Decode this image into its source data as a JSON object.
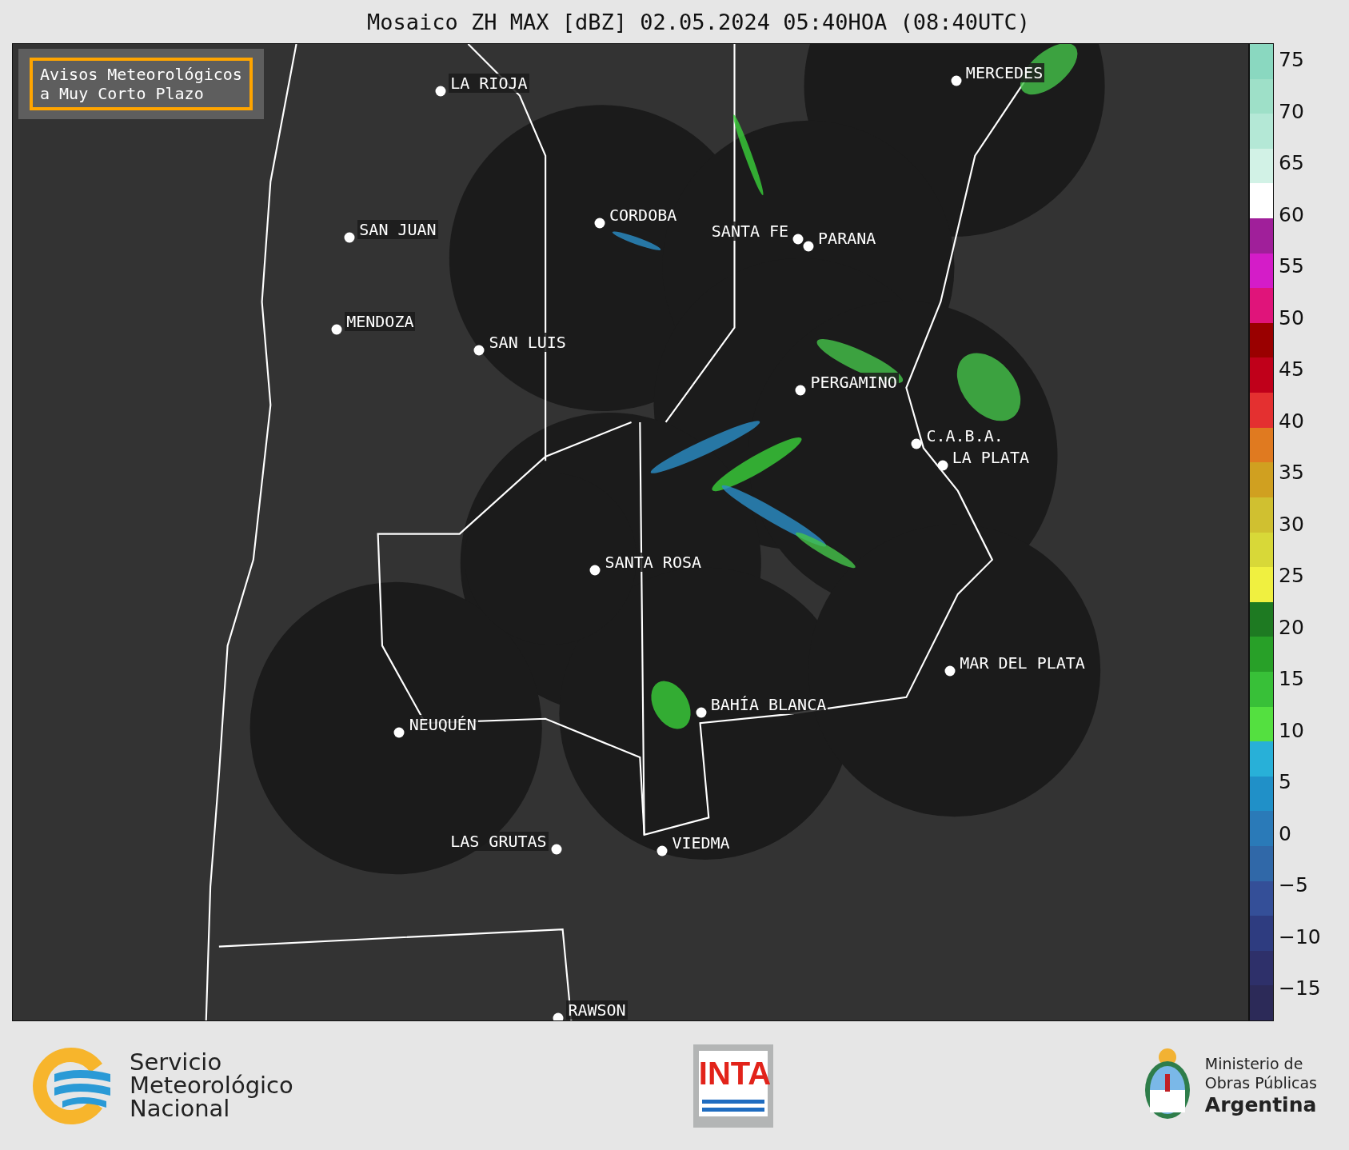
{
  "title": "Mosaico ZH MAX [dBZ] 02.05.2024 05:40HOA (08:40UTC)",
  "map": {
    "notice": [
      "Avisos Meteorológicos",
      "a Muy Corto Plazo"
    ],
    "cities": [
      {
        "name": "LA RIOJA"
      },
      {
        "name": "MERCEDES"
      },
      {
        "name": "CORDOBA"
      },
      {
        "name": "SAN JUAN"
      },
      {
        "name": "SANTA FE"
      },
      {
        "name": "PARANA"
      },
      {
        "name": "MENDOZA"
      },
      {
        "name": "SAN LUIS"
      },
      {
        "name": "PERGAMINO"
      },
      {
        "name": "C.A.B.A."
      },
      {
        "name": "LA PLATA"
      },
      {
        "name": "SANTA ROSA"
      },
      {
        "name": "MAR DEL PLATA"
      },
      {
        "name": "BAHÍA BLANCA"
      },
      {
        "name": "NEUQUÉN"
      },
      {
        "name": "LAS GRUTAS"
      },
      {
        "name": "VIEDMA"
      },
      {
        "name": "RAWSON"
      }
    ]
  },
  "colorbar": {
    "ticks": [
      "75",
      "70",
      "65",
      "60",
      "55",
      "50",
      "45",
      "40",
      "35",
      "30",
      "25",
      "20",
      "15",
      "10",
      "5",
      "0",
      "−5",
      "−10",
      "−15"
    ]
  },
  "footer": {
    "smn": [
      "Servicio",
      "Meteorológico",
      "Nacional"
    ],
    "inta": "INTA",
    "ministry": [
      "Ministerio de",
      "Obras Públicas",
      "Argentina"
    ]
  }
}
